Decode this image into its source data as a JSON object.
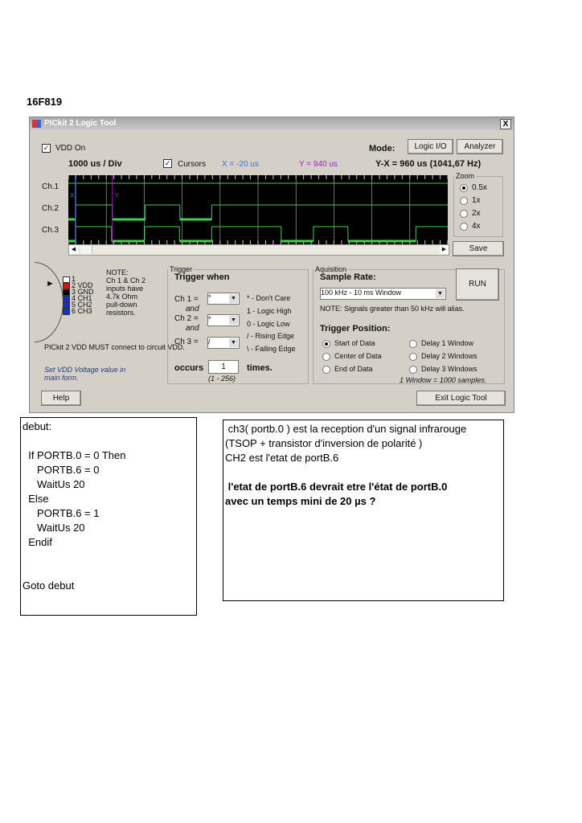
{
  "heading": "16F819",
  "window": {
    "title": "PICkit 2 Logic Tool",
    "close": "X"
  },
  "vdd_on": {
    "label": "VDD On",
    "checked": true
  },
  "mode": {
    "label": "Mode:",
    "logic_io": "Logic I/O",
    "analyzer": "Analyzer"
  },
  "timebase": "1000 us / Div",
  "cursors": {
    "label": "Cursors",
    "checked": true,
    "x": "X = -20 us",
    "y": "Y =  940 us",
    "yx": "Y-X =  960 us (1041,67 Hz)",
    "x_color": "#3a6fe0",
    "y_color": "#a020c0"
  },
  "channels": [
    "Ch.1",
    "Ch.2",
    "Ch.3"
  ],
  "zoom": {
    "label": "Zoom",
    "options": [
      "0.5x",
      "1x",
      "2x",
      "4x"
    ],
    "selected": "0.5x"
  },
  "save": "Save",
  "waveform": {
    "us_per_div": 1000,
    "divisions": 10,
    "cursor_x_us": 190,
    "cursor_y_us": 1160,
    "cursor_x_label": "X",
    "cursor_y_label": "Y",
    "trace_color": "#3fd24a",
    "ch1": {
      "start": 1,
      "transitions_us": []
    },
    "ch2": {
      "start": 0,
      "transitions_us": [
        190,
        1160,
        2030,
        2940,
        3780
      ]
    },
    "ch3": {
      "start": 0,
      "transitions_us": [
        190,
        1140,
        2010,
        2930,
        3780,
        5610,
        6460,
        7370,
        9160
      ]
    }
  },
  "pinout": {
    "pins": [
      "1",
      "2 VDD",
      "3 GND",
      "4 CH1",
      "5 CH2",
      "6 CH3"
    ],
    "colors": [
      "#ffffff",
      "#e01010",
      "#000000",
      "#1030d0",
      "#1030d0",
      "#1030d0"
    ],
    "note": [
      "NOTE:",
      "Ch 1 & Ch 2",
      "inputs have",
      "4.7k Ohm",
      "pull-down",
      "resistors."
    ],
    "vdd_note": "PICkit 2 VDD MUST connect to circuit VDD.",
    "vdd_hint": "Set VDD Voltage value in main form."
  },
  "trigger": {
    "legend": "Trigger",
    "title": "Trigger when",
    "ch1": "Ch 1 =",
    "ch2": "Ch 2 =",
    "ch3": "Ch 3 =",
    "and": "and",
    "ch1_val": "*",
    "ch2_val": "*",
    "ch3_val": "/",
    "key": [
      "* - Don't Care",
      "1 - Logic High",
      "0 - Logic Low",
      "/ - Rising Edge",
      "\\ - Falling Edge"
    ],
    "occurs": "occurs",
    "count": "1",
    "times": "times.",
    "range": "(1 - 256)"
  },
  "acquisition": {
    "legend": "Aquisition",
    "sample_rate_label": "Sample Rate:",
    "sample_rate": "100 kHz - 10 ms Window",
    "run": "RUN",
    "note": "NOTE: Signals greater than 50 kHz will alias.",
    "trigger_pos_label": "Trigger Position:",
    "positions": [
      "Start of Data",
      "Delay 1 Window",
      "Center of Data",
      "Delay 2 Windows",
      "End of Data",
      "Delay 3 Windows"
    ],
    "selected": "Start of Data",
    "window_note": "1 Window = 1000 samples."
  },
  "help": "Help",
  "exit": "Exit Logic Tool",
  "code": [
    "debut:",
    "",
    "  If PORTB.0 = 0 Then",
    "     PORTB.6 = 0",
    "     WaitUs 20",
    "  Else",
    "     PORTB.6 = 1",
    "     WaitUs 20",
    "  Endif",
    "",
    "",
    "Goto debut"
  ],
  "comment": {
    "lines": [
      " ch3( portb.0 ) est la reception d'un signal infrarouge",
      "(TSOP + transistor d'inversion de polarité )",
      "CH2 est l'etat de portB.6",
      ""
    ],
    "question": [
      " l'etat de portB.6 devrait etre l'état de portB.0",
      "avec un temps mini de 20 µs ?"
    ]
  }
}
